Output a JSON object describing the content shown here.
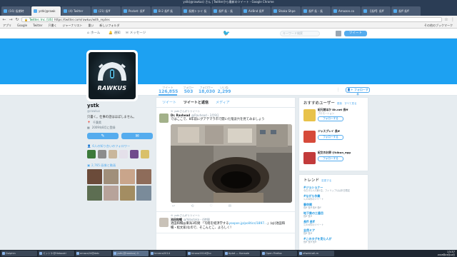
{
  "browser": {
    "window_title": "ystk(@rawkus) さん | Twitterから最新のツイート - Google Chrome",
    "tabs": [
      {
        "label": "(16) 長期時"
      },
      {
        "label": "ystk(@rawk",
        "active": true
      },
      {
        "label": "(4) Twitter"
      },
      {
        "label": "(21) 長ff"
      },
      {
        "label": "Pocket: 長ff"
      },
      {
        "label": "B-2 長ff 長"
      },
      {
        "label": "長期トライ 長"
      },
      {
        "label": "長ff 長 - 長"
      },
      {
        "label": "AirBnd 長ff"
      },
      {
        "label": "Shaka Shpe"
      },
      {
        "label": "長ff 長 - 長"
      },
      {
        "label": "Amazon.co"
      },
      {
        "label": "【長ff】長ff"
      },
      {
        "label": "長ff 長ff"
      }
    ],
    "url_prefix": "Twitter, Inc. [US]",
    "url": "https://twitter.com/rawkus/with_replies",
    "bookmarks": [
      "アプリ",
      "Google",
      "Twitter",
      "只書く",
      "ジャーナリスト",
      "重い",
      "新しいフォルダ"
    ],
    "bookmarks_right": "その他のブックマーク"
  },
  "twitter_nav": {
    "home": "ホーム",
    "notifications": "通知",
    "messages": "メッセージ",
    "search_placeholder": "キーワード検索",
    "tweet_button": "ツイート"
  },
  "profile": {
    "logo_text": "RAWKUS",
    "name": "ystk",
    "handle": "@rawkus",
    "bio": "只書く。仕事の話はほぼしません。",
    "location": "千葉県",
    "joined": "2009年8月に登録",
    "follow_button": "フォローする",
    "stats": [
      {
        "label": "ツイート",
        "value": "126,855"
      },
      {
        "label": "フォロー",
        "value": "503"
      },
      {
        "label": "フォロワー",
        "value": "18,030"
      },
      {
        "label": "いいね",
        "value": "2,299"
      }
    ],
    "followers_you_know": "6人の知り合いのフォロワー",
    "photos_videos": "2,765 画像と動画"
  },
  "timeline": {
    "tabs": [
      "ツイート",
      "ツイートと返信",
      "メディア"
    ],
    "tweets": [
      {
        "retweeted_by": "ystkさんがリツイート",
        "name": "Dr. Ravhead",
        "handle": "@Ravhead・3月9日",
        "text": "ではここで、8年前にグアテマラ市で開いた陥没穴を見てみましょう",
        "counts": {
          "reply": "",
          "retweet": "",
          "like": ""
        }
      },
      {
        "retweeted_by": "ystkさんがリツイート",
        "name": "池田和暢",
        "handle": "@Yobutaka・4時間",
        "text_prefix": "池田和暢@東海3年間 「写経を経済学する",
        "link": "yoxpos.jp/politics/1897...",
        "text_suffix": "」(q)(池田和暢・松文家)なので、そこんとこ、よろしく！"
      }
    ]
  },
  "who_to_follow": {
    "title": "おすすめユーザー",
    "refresh": "更新",
    "all": "すべて見る",
    "users": [
      {
        "name": "紀元前ほか 8h.net 長ff",
        "handle": "@kigen",
        "sub": "プロモーション",
        "button": "フォローする"
      },
      {
        "name": "ジャスプレイ 長ff",
        "handle": "@jaspray",
        "sub": "",
        "button": "フォローする"
      },
      {
        "name": "紀文のお卵 @kibun_egg",
        "handle": "",
        "sub": "",
        "button": "フォローする"
      }
    ]
  },
  "trends": {
    "title": "トレンド",
    "change": "変更する",
    "items": [
      {
        "name": "#ジョショナー",
        "sub": "今だけ(いい)第1位、フィリップ以は本日限定"
      },
      {
        "name": "#ながら作業",
        "sub": "1,234件のツイート"
      },
      {
        "name": "春休暇",
        "sub": "長ff 長ff 長ff 長ff"
      },
      {
        "name": "地下鉄の三番目",
        "sub": "長ff 長ff"
      },
      {
        "name": "長ff 長ff",
        "sub": "1,034件のツイート"
      },
      {
        "name": "全然ミア",
        "sub": "長ff 長ff"
      },
      {
        "name": "#このタグを見た人が",
        "sub": "長ff 長ff 長ff"
      }
    ]
  },
  "taskbar": {
    "items": [
      "Dolphin",
      "ミントケ@Hebookl",
      "emacs24@deb",
      "ystk(@rawkus) 2.",
      "hmmro2014",
      "hirono2014@cc",
      "tiplot — Konsole",
      "Open Firefox",
      "xfwebl:all-m"
    ],
    "active_index": 3,
    "time": "13:37",
    "date": "2018年03月12日"
  },
  "colors": {
    "twitter_blue": "#55acee",
    "banner": "#1da1f2",
    "background": "#e6ecf0"
  }
}
